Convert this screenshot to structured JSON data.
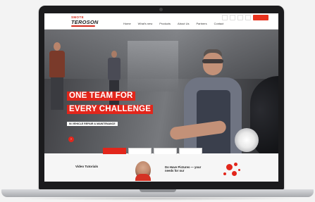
{
  "site": {
    "logo_top": "SMOTE",
    "logo_main": "TEROSON",
    "topbar": [
      "",
      "",
      "",
      "",
      ""
    ],
    "nav": [
      "Home",
      "What's new",
      "Products",
      "About Us",
      "Partners",
      "Contact"
    ]
  },
  "hero": {
    "headline_1": "ONE TEAM FOR",
    "headline_2": "EVERY CHALLENGE",
    "subline": "IN VEHICLE REPAIR & MAINTENANCE",
    "description": "",
    "cta_icon": "›",
    "cta_label": ""
  },
  "tabs": [
    {
      "label": "",
      "active": true
    },
    {
      "label": "",
      "active": false
    },
    {
      "label": "",
      "active": false
    },
    {
      "label": "",
      "active": false
    }
  ],
  "bottom": {
    "card1_title": "Video Tutorials",
    "card1_text": "",
    "card2_title": "Do Have Pictures — your needs for our",
    "card2_text": ""
  },
  "colors": {
    "accent": "#e2261b",
    "laptop": "#1b1b1d"
  },
  "icons": {
    "cta": "chevron-right-icon"
  }
}
